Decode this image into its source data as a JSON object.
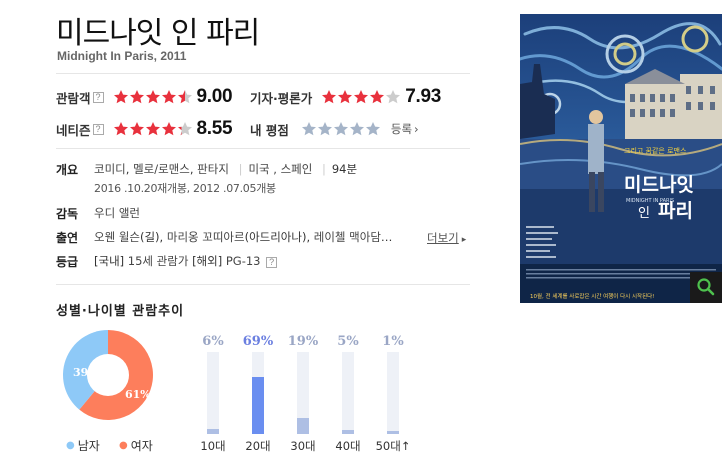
{
  "movie": {
    "title": "미드나잇 인 파리",
    "subtitle": "Midnight In Paris, 2011"
  },
  "ratings": {
    "audience": {
      "label": "관람객",
      "help": "?",
      "score": "9.00",
      "stars": 4.5
    },
    "critic": {
      "label": "기자·평론가",
      "score": "7.93",
      "stars": 4.0
    },
    "netizen": {
      "label": "네티즌",
      "help": "?",
      "score": "8.55",
      "stars": 4.25
    },
    "mine": {
      "label": "내 평점",
      "signup": "등록",
      "chevron": "›",
      "stars": 0
    },
    "colors": {
      "star_filled": "#e8313d",
      "star_empty": "#cccccc",
      "star_mine": "#a5b4c8"
    }
  },
  "info": {
    "overview_label": "개요",
    "genres": [
      "코미디",
      "멜로/로맨스",
      "판타지"
    ],
    "genre_sep": ", ",
    "pipe": "|",
    "countries": "미국 , 스페인",
    "runtime": "94분",
    "release": "2016 .10.20재개봉, 2012 .07.05개봉",
    "director_label": "감독",
    "director": "우디 앨런",
    "cast_label": "출연",
    "cast_a": "오웬 윌슨",
    "cast_a_role": "(길), ",
    "cast_b": "마리옹 꼬띠아르",
    "cast_b_role": "(아드리아나), ",
    "cast_c": "레이첼 맥아담",
    "cast_more_dots": "…",
    "more": "더보기",
    "more_arrow": "▸",
    "grade_label": "등급",
    "grade_kr_prefix": "[국내]",
    "grade_kr": "15세 관람가",
    "grade_intl_prefix": "[해외]",
    "grade_intl": "PG-13",
    "grade_help": "?"
  },
  "poster": {
    "title_main": "미드나잇",
    "title_in": "인",
    "title_paris": "파리",
    "romance_line": "그리고 꿈같은 로맨스",
    "english_title": "MIDNIGHT IN PARIS",
    "tagline": "10월, 전 세계를 사로잡은 시간 여행이 다시 시작된다!",
    "search_icon": "magnifier-icon"
  },
  "trend": {
    "title": "성별·나이별 관람추이",
    "gender": {
      "male_pct": 39,
      "female_pct": 61,
      "male_label": "남자",
      "female_label": "여자",
      "male_color": "#8ec9f7",
      "female_color": "#fd7e5c"
    },
    "ages": [
      {
        "label": "10대",
        "pct": 6,
        "text": "6%"
      },
      {
        "label": "20대",
        "pct": 69,
        "text": "69%"
      },
      {
        "label": "30대",
        "pct": 19,
        "text": "19%"
      },
      {
        "label": "40대",
        "pct": 5,
        "text": "5%"
      },
      {
        "label": "50대↑",
        "pct": 1,
        "text": "1%"
      }
    ],
    "highlight_color": "#6a8ef0",
    "highlight_text_color": "#6b7fe0",
    "normal_color": "#aebfe4",
    "track_color": "#eef1f7"
  }
}
